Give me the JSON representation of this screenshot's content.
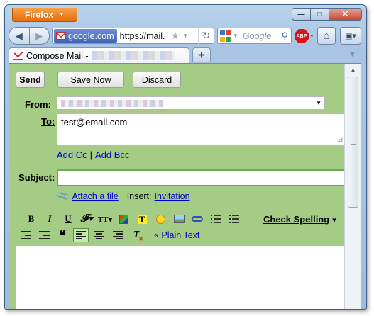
{
  "browser": {
    "menu_button": "Firefox",
    "window_controls": {
      "minimize": "—",
      "maximize": "□",
      "close": "✕"
    },
    "url_identity": "google.com",
    "url_text": "https://mail.",
    "search_placeholder": "Google",
    "adblock_label": "ABP",
    "tab": {
      "title": "Compose Mail -"
    },
    "new_tab": "+"
  },
  "compose": {
    "buttons": {
      "send": "Send",
      "save": "Save Now",
      "discard": "Discard"
    },
    "from_label": "From:",
    "to_label": "To:",
    "to_value": "test@email.com",
    "add_cc": "Add Cc",
    "add_cc_sep": "|",
    "add_bcc": "Add Bcc",
    "subject_label": "Subject:",
    "subject_value": "",
    "attach_label": "Attach a file",
    "insert_label": "Insert:",
    "invitation_label": "Invitation",
    "check_spelling": "Check Spelling",
    "check_spelling_arrow": "▾",
    "plain_text": "« Plain Text"
  },
  "colors": {
    "compose_background": "#a4cc85",
    "link": "#0000cc",
    "firefox_orange": "#e86c0a",
    "window_frame": "#a9c5e3"
  }
}
